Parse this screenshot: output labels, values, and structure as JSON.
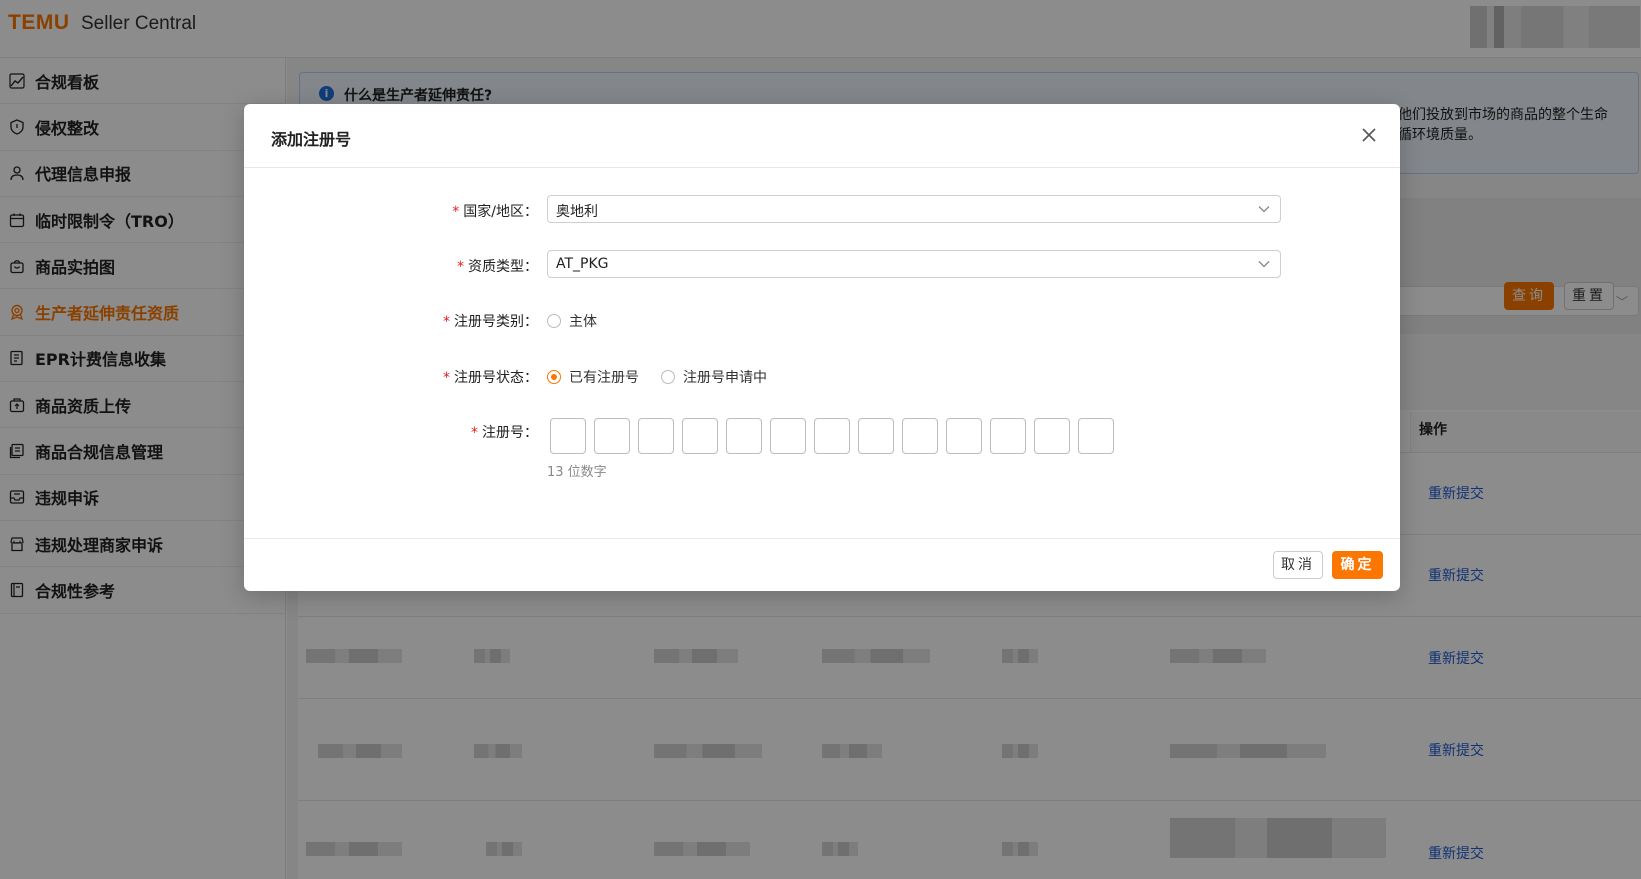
{
  "header": {
    "logo": "TEMU",
    "title": "Seller Central"
  },
  "sidebar": {
    "items": [
      {
        "label": "合规看板",
        "icon": "chart-line-icon",
        "active": false
      },
      {
        "label": "侵权整改",
        "icon": "shield-icon",
        "active": false
      },
      {
        "label": "代理信息申报",
        "icon": "user-icon",
        "active": false
      },
      {
        "label": "临时限制令（TRO）",
        "icon": "calendar-icon",
        "active": false
      },
      {
        "label": "商品实拍图",
        "icon": "bag-icon",
        "active": false
      },
      {
        "label": "生产者延伸责任资质",
        "icon": "badge-icon",
        "active": true
      },
      {
        "label": "EPR计费信息收集",
        "icon": "document-icon",
        "active": false
      },
      {
        "label": "商品资质上传",
        "icon": "upload-icon",
        "active": false
      },
      {
        "label": "商品合规信息管理",
        "icon": "files-icon",
        "active": false
      },
      {
        "label": "违规申诉",
        "icon": "inbox-icon",
        "active": false
      },
      {
        "label": "违规处理商家申诉",
        "icon": "shop-icon",
        "active": false
      },
      {
        "label": "合规性参考",
        "icon": "book-icon",
        "active": false
      }
    ]
  },
  "main": {
    "info_title": "什么是生产者延伸责任?",
    "info_text_1": "他们投放到市场的商品的整个生命",
    "info_text_2": "循环境质量。",
    "query_button": "查询",
    "reset_button": "重置",
    "table_header_op": "操作",
    "resubmit_label": "重新提交"
  },
  "modal": {
    "title": "添加注册号",
    "country_label": "国家/地区",
    "country_value": "奥地利",
    "type_label": "资质类型",
    "type_value": "AT_PKG",
    "reg_category_label": "注册号类别",
    "reg_category_options": [
      "主体"
    ],
    "reg_status_label": "注册号状态",
    "reg_status_options": [
      "已有注册号",
      "注册号申请中"
    ],
    "reg_status_selected": "已有注册号",
    "reg_number_label": "注册号",
    "reg_number_digits": 13,
    "reg_number_hint": "13 位数字",
    "cancel_label": "取消",
    "ok_label": "确定"
  },
  "colors": {
    "accent": "#fb7701",
    "link": "#1f5bd6",
    "required": "#e02020"
  }
}
